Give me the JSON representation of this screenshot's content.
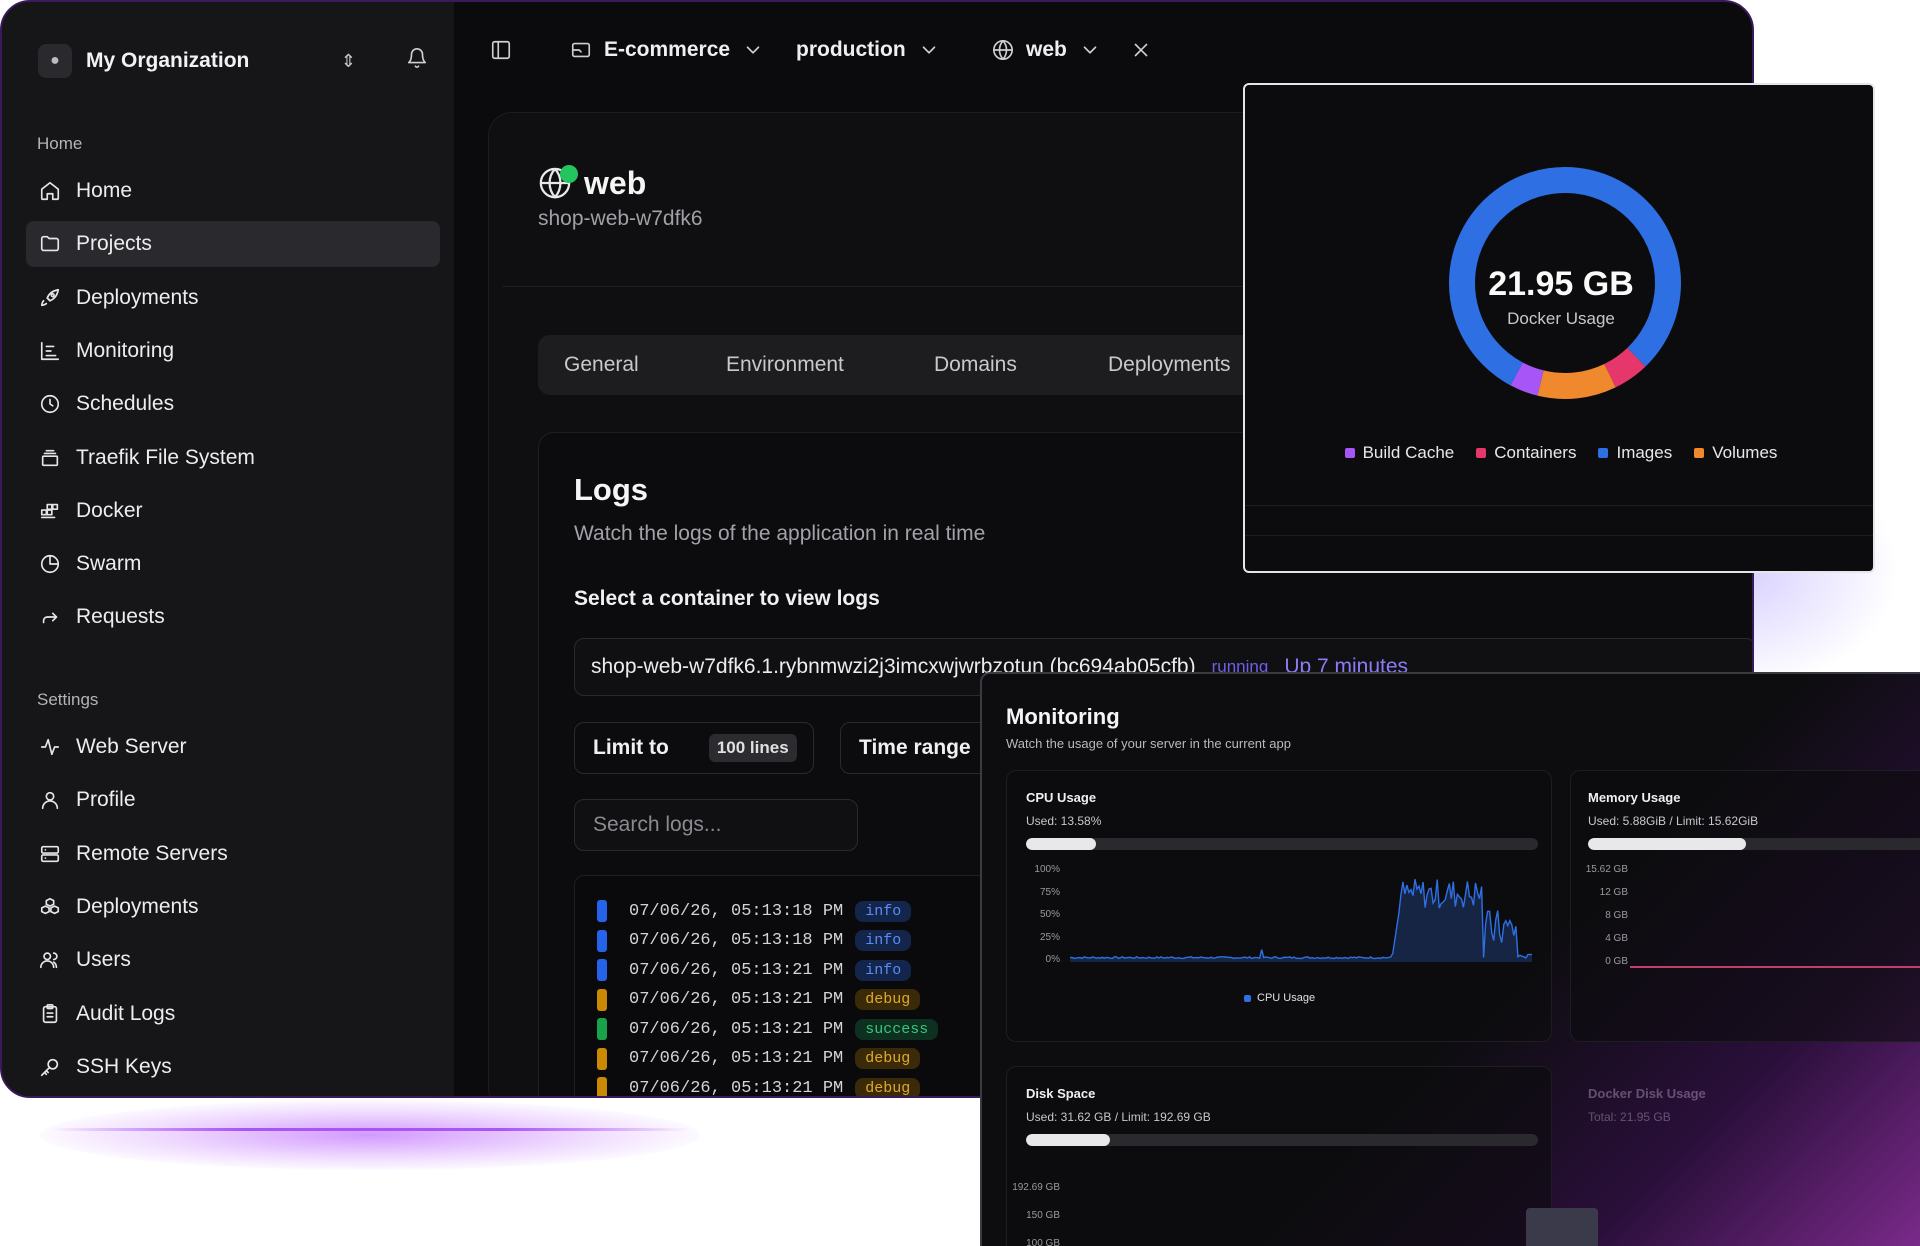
{
  "sidebar": {
    "org_name": "My Organization",
    "home_section": "Home",
    "home_items": [
      {
        "label": "Home",
        "icon": "home-icon"
      },
      {
        "label": "Projects",
        "icon": "folder-icon",
        "active": true
      },
      {
        "label": "Deployments",
        "icon": "rocket-icon"
      },
      {
        "label": "Monitoring",
        "icon": "monitoring-icon"
      },
      {
        "label": "Schedules",
        "icon": "clock-icon"
      },
      {
        "label": "Traefik File System",
        "icon": "file-system-icon"
      },
      {
        "label": "Docker",
        "icon": "docker-icon"
      },
      {
        "label": "Swarm",
        "icon": "pie-icon"
      },
      {
        "label": "Requests",
        "icon": "forward-arrow-icon"
      }
    ],
    "settings_section": "Settings",
    "settings_items": [
      {
        "label": "Web Server",
        "icon": "activity-icon"
      },
      {
        "label": "Profile",
        "icon": "user-icon"
      },
      {
        "label": "Remote Servers",
        "icon": "server-icon"
      },
      {
        "label": "Deployments",
        "icon": "boxes-icon"
      },
      {
        "label": "Users",
        "icon": "users-icon"
      },
      {
        "label": "Audit Logs",
        "icon": "clipboard-icon"
      },
      {
        "label": "SSH Keys",
        "icon": "key-icon"
      }
    ]
  },
  "topbar": {
    "project": "E-commerce",
    "environment": "production",
    "service": "web"
  },
  "service": {
    "title": "web",
    "app_name": "shop-web-w7dfk6",
    "status_color": "#22c55e"
  },
  "tabs": [
    "General",
    "Environment",
    "Domains",
    "Deployments"
  ],
  "logs": {
    "title": "Logs",
    "subtitle": "Watch the logs of the application in real time",
    "select_label": "Select a container to view logs",
    "container_name": "shop-web-w7dfk6.1.rybnmwzi2j3imcxwjwrbzotun (bc694ab05cfb)",
    "container_status": "running",
    "container_uptime": "Up 7 minutes",
    "limit_label": "Limit to",
    "limit_value": "100 lines",
    "time_range_label": "Time range",
    "search_placeholder": "Search logs...",
    "rows": [
      {
        "time": "07/06/26, 05:13:18 PM",
        "level": "info",
        "color": "#2563eb"
      },
      {
        "time": "07/06/26, 05:13:18 PM",
        "level": "info",
        "color": "#2563eb"
      },
      {
        "time": "07/06/26, 05:13:21 PM",
        "level": "info",
        "color": "#2563eb"
      },
      {
        "time": "07/06/26, 05:13:21 PM",
        "level": "debug",
        "color": "#ca8a04"
      },
      {
        "time": "07/06/26, 05:13:21 PM",
        "level": "success",
        "color": "#16a34a"
      },
      {
        "time": "07/06/26, 05:13:21 PM",
        "level": "debug",
        "color": "#ca8a04"
      },
      {
        "time": "07/06/26, 05:13:21 PM",
        "level": "debug",
        "color": "#ca8a04"
      }
    ]
  },
  "docker": {
    "value": "21.95 GB",
    "label": "Docker Usage",
    "legend": [
      {
        "name": "Build Cache",
        "color": "#a855f7"
      },
      {
        "name": "Containers",
        "color": "#e5376b"
      },
      {
        "name": "Images",
        "color": "#2f6fe4"
      },
      {
        "name": "Volumes",
        "color": "#f0882e"
      }
    ],
    "slices": [
      {
        "name": "Images",
        "fraction": 0.8,
        "color": "#2f6fe4"
      },
      {
        "name": "Containers",
        "fraction": 0.05,
        "color": "#e5376b"
      },
      {
        "name": "Volumes",
        "fraction": 0.11,
        "color": "#f0882e"
      },
      {
        "name": "Build Cache",
        "fraction": 0.04,
        "color": "#a855f7"
      }
    ]
  },
  "monitoring": {
    "title": "Monitoring",
    "subtitle": "Watch the usage of your server in the current app",
    "cpu": {
      "name": "CPU Usage",
      "used": "Used: 13.58%",
      "fraction": 0.1358,
      "ticks": [
        "100%",
        "75%",
        "50%",
        "25%",
        "0%"
      ],
      "legend": "CPU Usage",
      "color": "#2f6fe4"
    },
    "memory": {
      "name": "Memory Usage",
      "used": "Used: 5.88GiB / Limit: 15.62GiB",
      "fraction": 0.376,
      "ticks": [
        "15.62 GB",
        "12 GB",
        "8 GB",
        "4 GB",
        "0 GB"
      ]
    },
    "disk": {
      "name": "Disk Space",
      "used": "Used: 31.62 GB / Limit: 192.69 GB",
      "fraction": 0.164,
      "ticks": [
        "192.69 GB",
        "150 GB",
        "100 GB"
      ]
    },
    "docker_disk": {
      "name": "Docker Disk Usage",
      "total": "Total: 21.95 GB"
    }
  }
}
